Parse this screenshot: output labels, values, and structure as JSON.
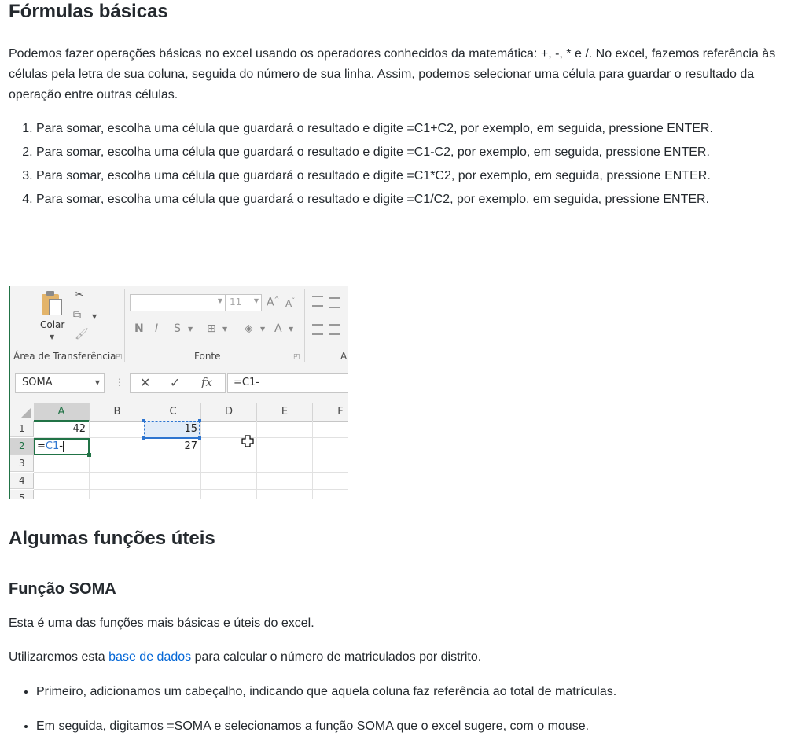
{
  "section1": {
    "title": "Fórmulas básicas",
    "intro": "Podemos fazer operações básicas no excel usando os operadores conhecidos da matemática: +, -, * e /. No excel, fazemos referência às células pela letra de sua coluna, seguida do número de sua linha. Assim, podemos selecionar uma célula para guardar o resultado da operação entre outras células.",
    "steps": [
      "Para somar, escolha uma célula que guardará o resultado e digite =C1+C2, por exemplo, em seguida, pressione ENTER.",
      "Para somar, escolha uma célula que guardará o resultado e digite =C1-C2, por exemplo, em seguida, pressione ENTER.",
      "Para somar, escolha uma célula que guardará o resultado e digite =C1*C2, por exemplo, em seguida, pressione ENTER.",
      "Para somar, escolha uma célula que guardará o resultado e digite =C1/C2, por exemplo, em seguida, pressione ENTER."
    ]
  },
  "excel": {
    "paste_label": "Colar",
    "clipboard_group": "Área de Transferência",
    "font_group": "Fonte",
    "align_group_partial": "Al",
    "font_size": "11",
    "bold": "N",
    "italic": "I",
    "underline": "S",
    "name_box": "SOMA",
    "cancel_symbol": "✕",
    "enter_symbol": "✓",
    "fx_symbol": "fx",
    "formula": "=C1-",
    "columns": [
      "A",
      "B",
      "C",
      "D",
      "E",
      "F"
    ],
    "rows": [
      "1",
      "2",
      "3",
      "4",
      "5"
    ],
    "cells": {
      "A1": "42",
      "C1": "15",
      "C2": "27",
      "A2_prefix": "=",
      "A2_ref": "C1",
      "A2_suffix": "-"
    },
    "accent_color": "#217346",
    "reference_color": "#2e75d0"
  },
  "section2": {
    "title": "Algumas funções úteis",
    "subtitle": "Função SOMA",
    "desc": "Esta é uma das funções mais básicas e úteis do excel.",
    "base_prefix": "Utilizaremos esta ",
    "base_link": "base de dados",
    "base_suffix": " para calcular o número de matriculados por distrito.",
    "bullets": [
      "Primeiro, adicionamos um cabeçalho, indicando que aquela coluna faz referência ao total de matrículas.",
      "Em seguida, digitamos =SOMA e selecionamos a função SOMA que o excel sugere, com o mouse."
    ],
    "link_color": "#0366d6"
  }
}
